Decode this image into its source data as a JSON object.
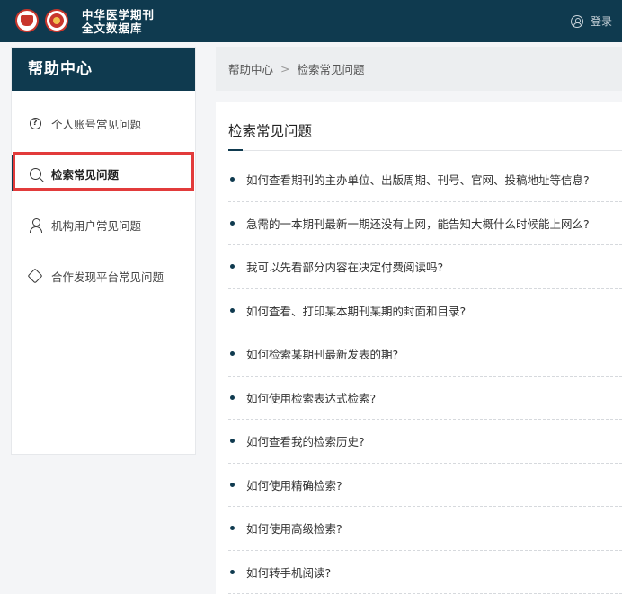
{
  "header": {
    "brand_line1": "中华医学期刊",
    "brand_line2": "全文数据库",
    "login_label": "登录",
    "icons": [
      "logo-emblem-icon",
      "logo-seal-icon",
      "user-circle-icon"
    ]
  },
  "sidebar": {
    "title": "帮助中心",
    "items": [
      {
        "label": "个人账号常见问题",
        "icon": "question-circle-icon",
        "active": false
      },
      {
        "label": "检索常见问题",
        "icon": "search-chat-icon",
        "active": true
      },
      {
        "label": "机构用户常见问题",
        "icon": "person-icon",
        "active": false
      },
      {
        "label": "合作发现平台常见问题",
        "icon": "tag-icon",
        "active": false
      }
    ]
  },
  "breadcrumb": {
    "home": "帮助中心",
    "separator": ">",
    "current": "检索常见问题"
  },
  "main": {
    "title": "检索常见问题",
    "faqs": [
      "如何查看期刊的主办单位、出版周期、刊号、官网、投稿地址等信息?",
      "急需的一本期刊最新一期还没有上网，能告知大概什么时候能上网么?",
      "我可以先看部分内容在决定付费阅读吗?",
      "如何查看、打印某本期刊某期的封面和目录?",
      "如何检索某期刊最新发表的期?",
      "如何使用检索表达式检索?",
      "如何查看我的检索历史?",
      "如何使用精确检索?",
      "如何使用高级检索?",
      "如何转手机阅读?"
    ]
  },
  "colors": {
    "header_bg": "#0f3a4f",
    "highlight_border": "#e23b3b",
    "bullet": "#0f3a4f"
  }
}
